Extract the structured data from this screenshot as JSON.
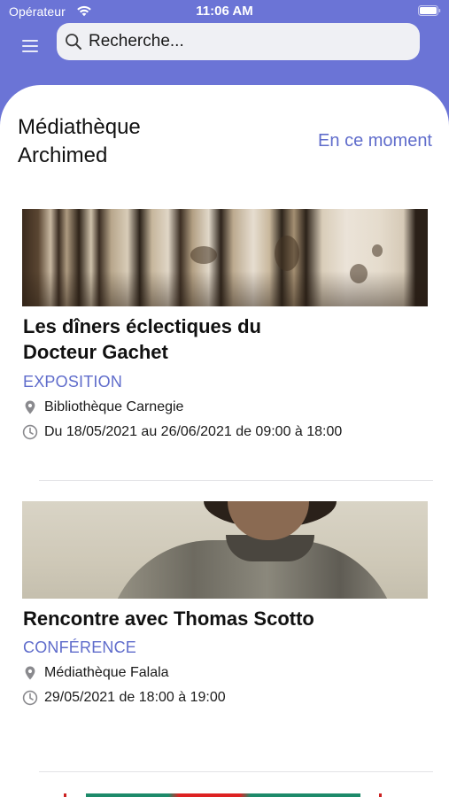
{
  "status_bar": {
    "carrier": "Opérateur",
    "time": "11:06 AM"
  },
  "header": {
    "menu_icon": "hamburger-menu-icon",
    "search": {
      "placeholder": "Recherche...",
      "icon": "search-icon"
    }
  },
  "main": {
    "title": "Médiathèque Archimed",
    "now_link": "En ce moment",
    "events": [
      {
        "title": "Les dîners éclectiques du Docteur Gachet",
        "type": "EXPOSITION",
        "location": "Bibliothèque Carnegie",
        "dates": "Du 18/05/2021 au 26/06/2021 de 09:00 à 18:00"
      },
      {
        "title": "Rencontre avec Thomas Scotto",
        "type": "CONFÉRENCE",
        "location": "Médiathèque Falala",
        "dates": "29/05/2021 de 18:00 à 19:00"
      }
    ]
  },
  "colors": {
    "header_bg": "#6B74D6",
    "accent": "#5F6CCB",
    "search_bg": "#EFF0F4",
    "sheet_bg": "#FFFFFF"
  }
}
